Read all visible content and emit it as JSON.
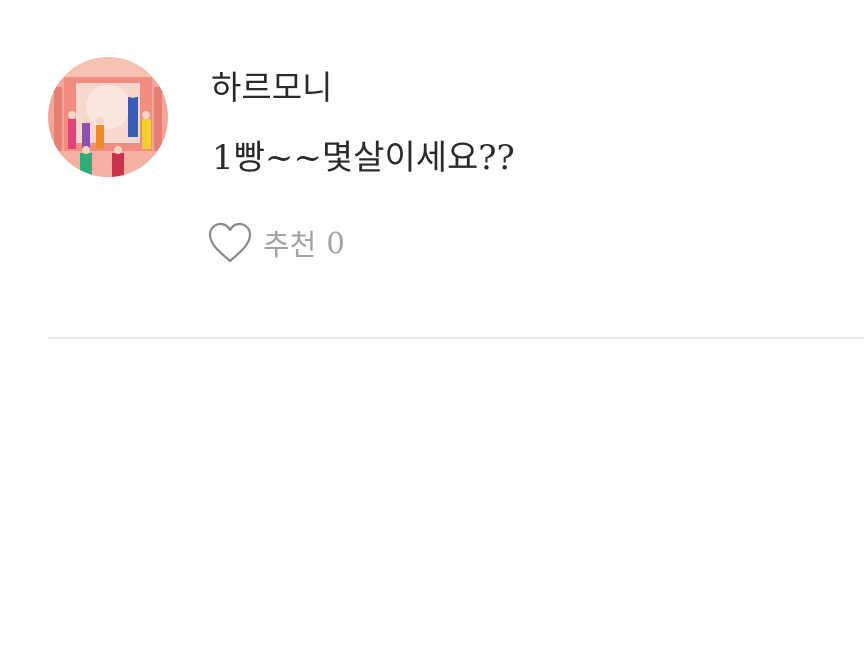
{
  "comment": {
    "username": "하르모니",
    "text": "1빵~~몇살이세요??",
    "like": {
      "icon": "heart-outline-icon",
      "label": "추천",
      "count": "0"
    }
  },
  "colors": {
    "text": "#2b2b2b",
    "muted": "#a2a2a2",
    "divider": "#e9e9e9",
    "avatar_bg": "#f3a79a"
  }
}
